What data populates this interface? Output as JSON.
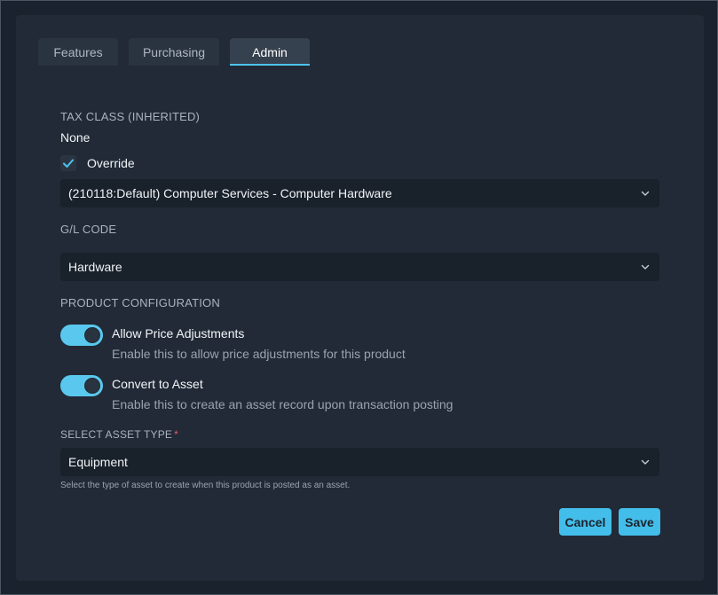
{
  "tabs": [
    {
      "label": "Features",
      "active": false
    },
    {
      "label": "Purchasing",
      "active": false
    },
    {
      "label": "Admin",
      "active": true
    }
  ],
  "tax_class": {
    "label": "TAX CLASS (INHERITED)",
    "value": "None",
    "override_label": "Override",
    "override_checked": true,
    "selected": "(210118:Default) Computer Services - Computer Hardware"
  },
  "gl_code": {
    "label": "G/L CODE",
    "selected": "Hardware"
  },
  "product_configuration": {
    "label": "PRODUCT CONFIGURATION",
    "toggles": [
      {
        "title": "Allow Price Adjustments",
        "description": "Enable this to allow price adjustments for this product",
        "on": true
      },
      {
        "title": "Convert to Asset",
        "description": "Enable this to create an asset record upon transaction posting",
        "on": true
      }
    ]
  },
  "asset_type": {
    "label": "SELECT ASSET TYPE",
    "required_mark": "*",
    "selected": "Equipment",
    "help": "Select the type of asset to create when this product is posted as an asset."
  },
  "actions": {
    "cancel_label": "Cancel",
    "save_label": "Save"
  },
  "colors": {
    "accent": "#43bde9",
    "toggle_on": "#5ac8ee",
    "required": "#e05a6a"
  }
}
